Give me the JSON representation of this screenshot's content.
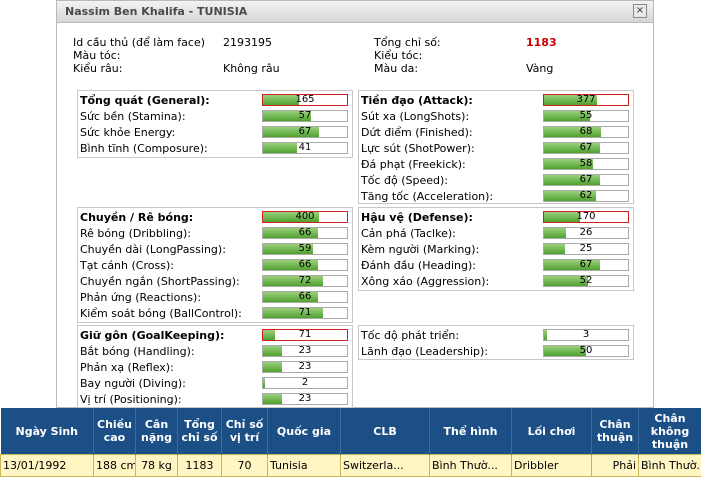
{
  "window": {
    "title": "Nassim Ben Khalifa - TUNISIA",
    "close_label": "×"
  },
  "info": {
    "face_id_label": "Id cầu thủ (để làm face)",
    "face_id": "2193195",
    "hair_color_label": "Màu tóc:",
    "hair_color": "",
    "beard_label": "Kiểu râu:",
    "beard": "Không râu",
    "total_label": "Tổng chỉ số:",
    "total": "1183",
    "hair_style_label": "Kiểu tóc:",
    "hair_style": "",
    "skin_label": "Màu da:",
    "skin": "Vàng"
  },
  "groups": {
    "general": [
      {
        "label": "Tổng quát (General):",
        "value": "165",
        "fill": 0.43,
        "head": true
      },
      {
        "label": "Sức bền (Stamina):",
        "value": "57",
        "fill": 0.57
      },
      {
        "label": "Sức khỏe Energy:",
        "value": "67",
        "fill": 0.67
      },
      {
        "label": "Bình tĩnh (Composure):",
        "value": "41",
        "fill": 0.41
      }
    ],
    "attack": [
      {
        "label": "Tiền đạo (Attack):",
        "value": "377",
        "fill": 0.63,
        "head": true
      },
      {
        "label": "Sút xa (LongShots):",
        "value": "55",
        "fill": 0.55
      },
      {
        "label": "Dứt điểm (Finished):",
        "value": "68",
        "fill": 0.68
      },
      {
        "label": "Lực sút (ShotPower):",
        "value": "67",
        "fill": 0.67
      },
      {
        "label": "Đá phạt (Freekick):",
        "value": "58",
        "fill": 0.58
      },
      {
        "label": "Tốc độ (Speed):",
        "value": "67",
        "fill": 0.67
      },
      {
        "label": "Tăng tốc (Acceleration):",
        "value": "62",
        "fill": 0.62
      }
    ],
    "dribbling": [
      {
        "label": "Chuyền / Rê bóng:",
        "value": "400",
        "fill": 0.67,
        "head": true
      },
      {
        "label": "Rê bóng (Dribbling):",
        "value": "66",
        "fill": 0.66
      },
      {
        "label": "Chuyền dài (LongPassing):",
        "value": "59",
        "fill": 0.59
      },
      {
        "label": "Tạt cánh (Cross):",
        "value": "66",
        "fill": 0.66
      },
      {
        "label": "Chuyền ngắn (ShortPassing):",
        "value": "72",
        "fill": 0.72
      },
      {
        "label": "Phản ứng (Reactions):",
        "value": "66",
        "fill": 0.66
      },
      {
        "label": "Kiểm soát bóng (BallControl):",
        "value": "71",
        "fill": 0.71
      }
    ],
    "defense": [
      {
        "label": "Hậu vệ (Defense):",
        "value": "170",
        "fill": 0.43,
        "head": true
      },
      {
        "label": "Cản phá (Taclke):",
        "value": "26",
        "fill": 0.26
      },
      {
        "label": "Kèm người (Marking):",
        "value": "25",
        "fill": 0.25
      },
      {
        "label": "Đánh đầu (Heading):",
        "value": "67",
        "fill": 0.67
      },
      {
        "label": "Xông xáo (Aggression):",
        "value": "52",
        "fill": 0.52
      }
    ],
    "goalkeeping": [
      {
        "label": "Giữ gôn (GoalKeeping):",
        "value": "71",
        "fill": 0.14,
        "head": true
      },
      {
        "label": "Bắt bóng (Handling):",
        "value": "23",
        "fill": 0.23
      },
      {
        "label": "Phản xạ (Reflex):",
        "value": "23",
        "fill": 0.23
      },
      {
        "label": "Bay người (Diving):",
        "value": "2",
        "fill": 0.02
      },
      {
        "label": "Vị trí (Positioning):",
        "value": "23",
        "fill": 0.23
      }
    ],
    "other": [
      {
        "label": "Tốc độ phát triển:",
        "value": "3",
        "fill": 0.03
      },
      {
        "label": "Lãnh đạo (Leadership):",
        "value": "50",
        "fill": 0.5
      }
    ]
  },
  "table": {
    "headers": [
      "Ngày Sinh",
      "Chiều cao",
      "Cân nặng",
      "Tổng chỉ số",
      "Chỉ số vị trí",
      "Quốc gia",
      "CLB",
      "Thể hình",
      "Lối chơi",
      "Chân thuận",
      "Chân không thuận"
    ],
    "row": [
      "13/01/1992",
      "188 cm",
      "78 kg",
      "1183",
      "70",
      "Tunisia",
      "Switzerla...",
      "Bình Thườ...",
      "Dribbler",
      "Phải",
      "Bình Thườ..."
    ]
  },
  "colors": {
    "header_bg": "#1c4f86",
    "row_bg": "#fff6c4",
    "bar_fill": "#4ea12e",
    "total": "#cc0000"
  }
}
